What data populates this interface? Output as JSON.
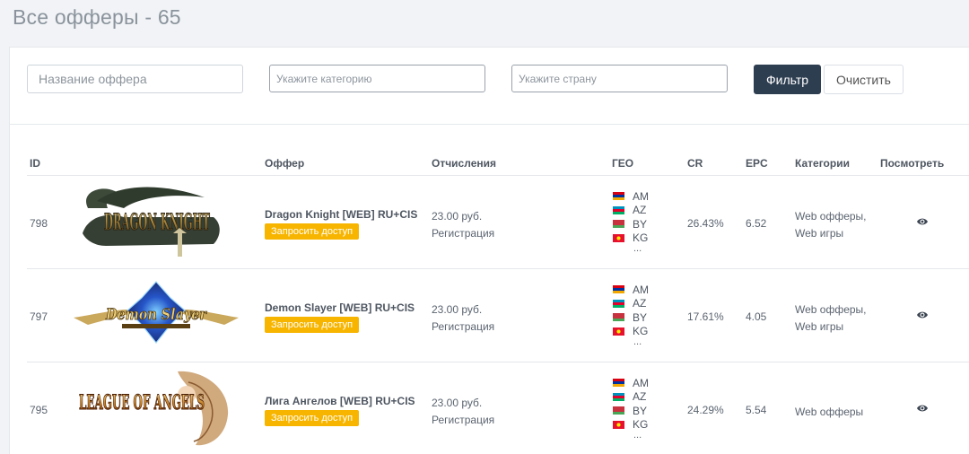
{
  "page": {
    "title": "Все офферы - 65"
  },
  "filters": {
    "name_placeholder": "Название оффера",
    "category_placeholder": "Укажите категорию",
    "country_placeholder": "Укажите страну",
    "filter_label": "Фильтр",
    "clear_label": "Очистить"
  },
  "table": {
    "headers": [
      "ID",
      "Оффер",
      "Отчисления",
      "ГЕО",
      "CR",
      "EPC",
      "Категории",
      "Посмотреть"
    ],
    "rows": [
      {
        "id": "798",
        "logo_text": "DRAGON KNIGHT",
        "name": "Dragon Knight [WEB] RU+CIS",
        "request_label": "Запросить доступ",
        "payout": "23.00 руб.",
        "payout_type": "Регистрация",
        "geo": [
          "AM",
          "AZ",
          "BY",
          "KG"
        ],
        "geo_more": "...",
        "cr": "26.43%",
        "epc": "6.52",
        "categories": [
          "Web офферы,",
          "Web игры"
        ],
        "view_icon": "eye-icon"
      },
      {
        "id": "797",
        "logo_text": "Demon Slayer",
        "name": "Demon Slayer [WEB] RU+CIS",
        "request_label": "Запросить доступ",
        "payout": "23.00 руб.",
        "payout_type": "Регистрация",
        "geo": [
          "AM",
          "AZ",
          "BY",
          "KG"
        ],
        "geo_more": "...",
        "cr": "17.61%",
        "epc": "4.05",
        "categories": [
          "Web офферы,",
          "Web игры"
        ],
        "view_icon": "eye-icon"
      },
      {
        "id": "795",
        "logo_text": "LEAGUE OF ANGELS",
        "name": "Лига Ангелов [WEB] RU+CIS",
        "request_label": "Запросить доступ",
        "payout": "23.00 руб.",
        "payout_type": "Регистрация",
        "geo": [
          "AM",
          "AZ",
          "BY",
          "KG"
        ],
        "geo_more": "...",
        "cr": "24.29%",
        "epc": "5.54",
        "categories": [
          "Web офферы"
        ],
        "view_icon": "eye-icon"
      }
    ]
  },
  "colors": {
    "primary_button": "#2e3e51",
    "request_button": "#f7b500",
    "background": "#f1f3f6"
  }
}
